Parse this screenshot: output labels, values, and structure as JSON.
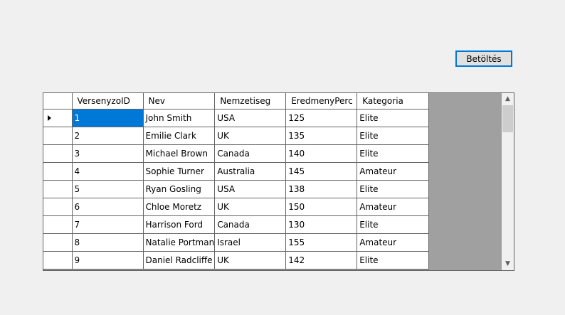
{
  "toolbar": {
    "load_label": "Betöltés"
  },
  "grid": {
    "columns": [
      "VersenyzoID",
      "Nev",
      "Nemzetiseg",
      "EredmenyPerc",
      "Kategoria"
    ],
    "rows": [
      [
        "1",
        "John Smith",
        "USA",
        "125",
        "Elite"
      ],
      [
        "2",
        "Emilie Clark",
        "UK",
        "135",
        "Elite"
      ],
      [
        "3",
        "Michael Brown",
        "Canada",
        "140",
        "Elite"
      ],
      [
        "4",
        "Sophie Turner",
        "Australia",
        "145",
        "Amateur"
      ],
      [
        "5",
        "Ryan Gosling",
        "USA",
        "138",
        "Elite"
      ],
      [
        "6",
        "Chloe Moretz",
        "UK",
        "150",
        "Amateur"
      ],
      [
        "7",
        "Harrison Ford",
        "Canada",
        "130",
        "Elite"
      ],
      [
        "8",
        "Natalie Portman",
        "Israel",
        "155",
        "Amateur"
      ],
      [
        "9",
        "Daniel Radcliffe",
        "UK",
        "142",
        "Elite"
      ]
    ],
    "selected_row": 0,
    "selected_col": 0,
    "current_row_icon": "current-row-arrow-icon"
  },
  "scrollbar": {
    "up_icon": "scroll-up-arrow-icon",
    "down_icon": "scroll-down-arrow-icon"
  },
  "colors": {
    "selection": "#0078d7",
    "grid_background": "#a0a0a0",
    "form_background": "#f0f0f0"
  }
}
